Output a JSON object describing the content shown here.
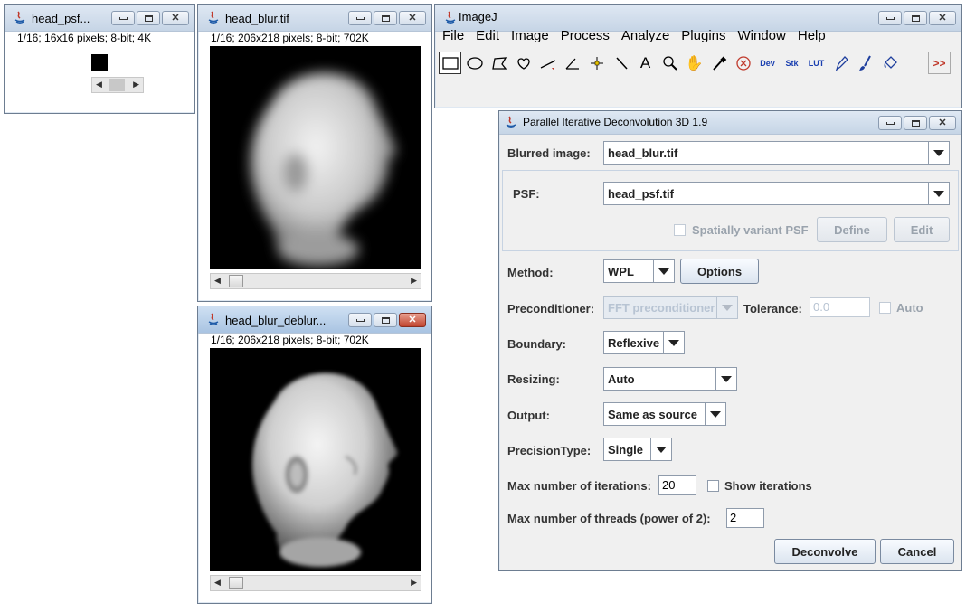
{
  "psf_window": {
    "title": "head_psf...",
    "info": "1/16; 16x16 pixels; 8-bit; 4K"
  },
  "blur_window": {
    "title": "head_blur.tif",
    "info": "1/16; 206x218 pixels; 8-bit; 702K"
  },
  "deblur_window": {
    "title": "head_blur_deblur...",
    "info": "1/16; 206x218 pixels; 8-bit; 702K"
  },
  "imagej": {
    "title": "ImageJ",
    "menus": [
      "File",
      "Edit",
      "Image",
      "Process",
      "Analyze",
      "Plugins",
      "Window",
      "Help"
    ],
    "tools": {
      "dev": "Dev",
      "stk": "Stk",
      "lut": "LUT",
      "more": ">>"
    }
  },
  "dialog": {
    "title": "Parallel Iterative Deconvolution 3D 1.9",
    "blurred_label": "Blurred image:",
    "blurred_value": "head_blur.tif",
    "psf_label": "PSF:",
    "psf_value": "head_psf.tif",
    "spatially_variant_label": "Spatially variant PSF",
    "define_label": "Define",
    "edit_label": "Edit",
    "method_label": "Method:",
    "method_value": "WPL",
    "options_label": "Options",
    "preconditioner_label": "Preconditioner:",
    "preconditioner_value": "FFT preconditioner",
    "tolerance_label": "Tolerance:",
    "tolerance_value": "0.0",
    "auto_label": "Auto",
    "boundary_label": "Boundary:",
    "boundary_value": "Reflexive",
    "resizing_label": "Resizing:",
    "resizing_value": "Auto",
    "output_label": "Output:",
    "output_value": "Same as source",
    "precision_label": "PrecisionType:",
    "precision_value": "Single",
    "max_iter_label": "Max number of iterations:",
    "max_iter_value": "20",
    "show_iter_label": "Show iterations",
    "max_threads_label": "Max number of threads (power of 2):",
    "max_threads_value": "2",
    "deconvolve_label": "Deconvolve",
    "cancel_label": "Cancel"
  }
}
